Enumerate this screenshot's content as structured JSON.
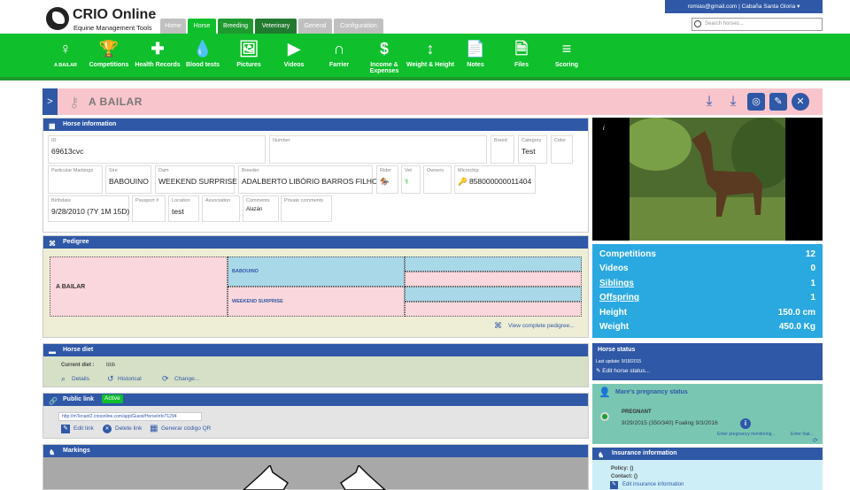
{
  "brand": {
    "title": "CRIO Online",
    "subtitle": "Equine Management Tools"
  },
  "nav_tabs": [
    {
      "label": "Home",
      "bg": "#c0c0c0"
    },
    {
      "label": "Horse",
      "bg": "#0fbf2c"
    },
    {
      "label": "Breeding",
      "bg": "#1f9a2e"
    },
    {
      "label": "Veterinary",
      "bg": "#207a30"
    },
    {
      "label": "General",
      "bg": "#c0c0c0"
    },
    {
      "label": "Configuration",
      "bg": "#c0c0c0"
    }
  ],
  "topbar": {
    "account": "romias@gmail.com  |  Cabaña Santa Gloria ▾"
  },
  "search": {
    "placeholder": "Search horses..."
  },
  "toolbar": [
    {
      "label": "A BAILAR",
      "icon": "♀"
    },
    {
      "label": "Competitions",
      "icon": "🏆"
    },
    {
      "label": "Health Records",
      "icon": "✚"
    },
    {
      "label": "Blood tests",
      "icon": "💧"
    },
    {
      "label": "Pictures",
      "icon": "🖼"
    },
    {
      "label": "Videos",
      "icon": "▶"
    },
    {
      "label": "Farrier",
      "icon": "∩"
    },
    {
      "label": "Income & Expenses",
      "icon": "$"
    },
    {
      "label": "Weight & Height",
      "icon": "↕"
    },
    {
      "label": "Notes",
      "icon": "📄"
    },
    {
      "label": "Files",
      "icon": "🗎"
    },
    {
      "label": "Scoring",
      "icon": "≡"
    }
  ],
  "horse": {
    "name": "A BAILAR"
  },
  "info": {
    "title": "Horse information",
    "fields": [
      {
        "label": "ID",
        "value": "69613cvc"
      },
      {
        "label": "Number",
        "value": ""
      },
      {
        "label": "Breed",
        "value": ""
      },
      {
        "label": "Category",
        "value": "Test"
      },
      {
        "label": "Color",
        "value": ""
      },
      {
        "label": "Particular Markings",
        "value": ""
      },
      {
        "label": "Sire",
        "value": "BABOUINO"
      },
      {
        "label": "Dam",
        "value": "WEEKEND SURPRISE"
      },
      {
        "label": "Breeder",
        "value": "ADALBERTO LIBÓRIO BARROS FILHO"
      },
      {
        "label": "Rider",
        "value": ""
      },
      {
        "label": "Vet",
        "value": ""
      },
      {
        "label": "Owners",
        "value": ""
      },
      {
        "label": "Microchip",
        "value": "🔑 858000000011404"
      },
      {
        "label": "Birthdate",
        "value": "9/28/2010 (7Y 1M 15D)"
      },
      {
        "label": "Passport #",
        "value": ""
      },
      {
        "label": "Location",
        "value": "test"
      },
      {
        "label": "Association",
        "value": ""
      },
      {
        "label": "Comments",
        "value": "Alazán"
      },
      {
        "label": "Private comments",
        "value": ""
      }
    ]
  },
  "pedigree": {
    "title": "Pedigree",
    "horse": "A BAILAR",
    "sire": "BABOUINO",
    "dam": "WEEKEND SURPRISE",
    "link": "View complete pedigree..."
  },
  "diet": {
    "title": "Horse diet",
    "current_label": "Current diet :",
    "current_value": "bbb",
    "details": "Details",
    "historical": "Historical",
    "change": "Change..."
  },
  "publink": {
    "title": "Public link",
    "badge": "Active",
    "url": "http://mTenant2.crioonline.com/app/Guest/HorseInfo?1294",
    "edit": "Edit link",
    "delete": "Delete link",
    "qr": "Generar código QR"
  },
  "markings": {
    "title": "Markings"
  },
  "photo": {
    "info": "i"
  },
  "stats": [
    {
      "label": "Competitions",
      "value": "12",
      "link": false
    },
    {
      "label": "Videos",
      "value": "0",
      "link": false
    },
    {
      "label": "Siblings",
      "value": "1",
      "link": true
    },
    {
      "label": "Offspring",
      "value": "1",
      "link": true
    },
    {
      "label": "Height",
      "value": "150.0 cm",
      "link": false
    },
    {
      "label": "Weight",
      "value": "450.0 Kg",
      "link": false
    }
  ],
  "status": {
    "title": "Horse status",
    "updated": "Last update: 9/18/2015",
    "edit": "Edit horse status..."
  },
  "pregnancy": {
    "title": "Mare's pregnancy status",
    "state": "PREGNANT",
    "detail": "9/29/2015 (350/340) Foaling 9/3/2016",
    "enter": "Enter pregnancy monitoring...",
    "foal": "Enter foal..."
  },
  "insurance": {
    "title": "Insurance information",
    "policy": "Policy:  ()",
    "contact": "Contact:  ()",
    "edit": "Edit insurance information"
  },
  "colors": {
    "blue": "#2f58a6",
    "green": "#0fbf2c",
    "pink": "#f9c5cd",
    "lightblue": "#a9d8e8"
  }
}
